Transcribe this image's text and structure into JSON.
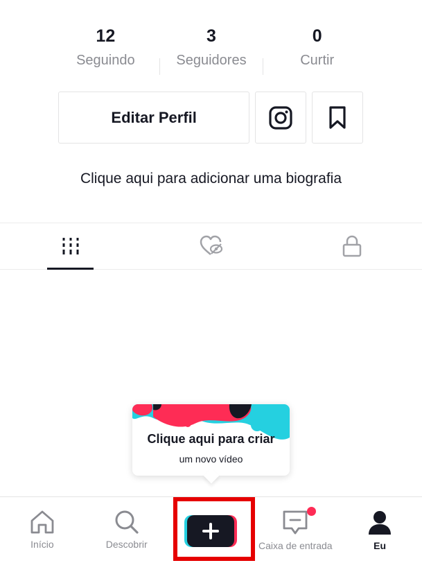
{
  "stats": [
    {
      "value": "12",
      "label": "Seguindo"
    },
    {
      "value": "3",
      "label": "Seguidores"
    },
    {
      "value": "0",
      "label": "Curtir"
    }
  ],
  "actions": {
    "edit_label": "Editar Perfil",
    "instagram_icon": "instagram-icon",
    "bookmark_icon": "bookmark-icon"
  },
  "bio": {
    "prompt": "Clique aqui para adicionar uma biografia"
  },
  "tabs": [
    {
      "icon": "videos-grid-icon",
      "active": true
    },
    {
      "icon": "liked-hidden-icon",
      "active": false
    },
    {
      "icon": "private-lock-icon",
      "active": false
    }
  ],
  "tooltip": {
    "title": "Clique aqui para criar",
    "subtitle": "um novo vídeo"
  },
  "nav": {
    "items": [
      {
        "label": "Início",
        "icon": "home-icon"
      },
      {
        "label": "Descobrir",
        "icon": "search-icon"
      },
      {
        "label": "",
        "icon": "plus-icon"
      },
      {
        "label": "Caixa de entrada",
        "icon": "inbox-icon"
      },
      {
        "label": "Eu",
        "icon": "profile-icon"
      }
    ]
  },
  "colors": {
    "text": "#161823",
    "muted": "#8a8b91",
    "accent_pink": "#fe2c55",
    "accent_cyan": "#25f4ee",
    "highlight_red": "#e60000"
  }
}
